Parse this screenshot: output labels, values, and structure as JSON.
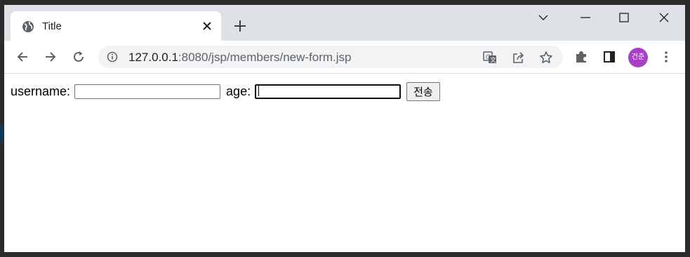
{
  "browser": {
    "tab": {
      "title": "Title",
      "favicon": "globe-icon"
    },
    "address_bar": {
      "host": "127.0.0.1",
      "rest": ":8080/jsp/members/new-form.jsp"
    },
    "profile": {
      "initials": "건준",
      "color": "#a83fc6"
    }
  },
  "form": {
    "username_label": "username:",
    "username_value": "",
    "age_label": "age:",
    "age_value": "",
    "submit_label": "전송"
  }
}
